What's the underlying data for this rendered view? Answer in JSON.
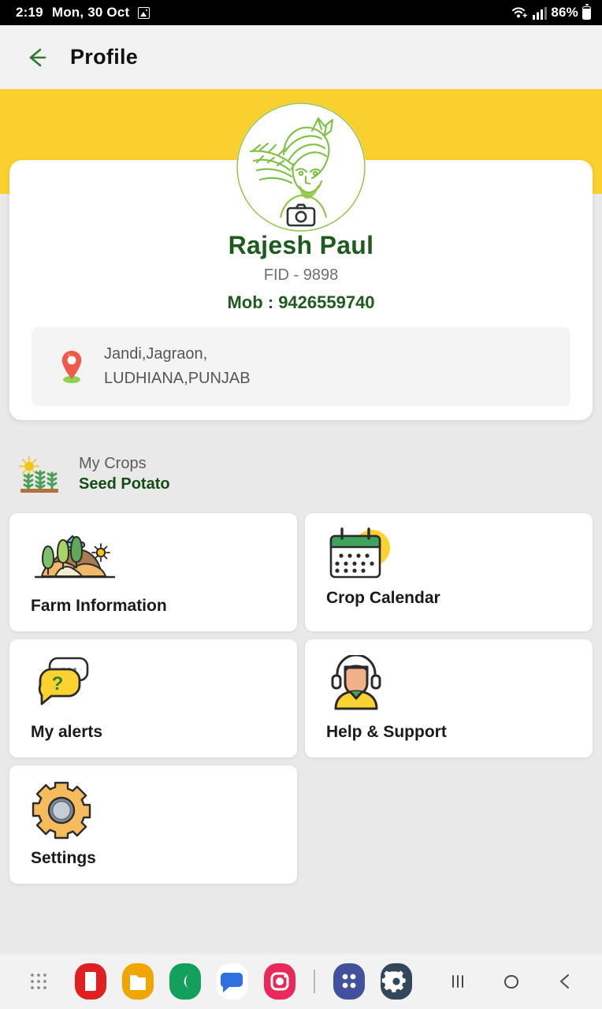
{
  "status_bar": {
    "time": "2:19",
    "date": "Mon, 30 Oct",
    "notification_icon": "image-icon",
    "wifi_icon": "wifi-icon",
    "signal_icon": "cellular-signal-icon",
    "battery_percent": "86%",
    "battery_icon": "battery-icon"
  },
  "header": {
    "back_icon": "back-arrow-icon",
    "title": "Profile",
    "accent_color": "#1d5c1d"
  },
  "banner": {
    "color": "#fad02e"
  },
  "profile": {
    "avatar_icon": "farmer-avatar-icon",
    "camera_icon": "camera-icon",
    "name": "Rajesh Paul",
    "fid": "FID - 9898",
    "mobile": "Mob : 9426559740",
    "location_icon": "location-pin-icon",
    "address_line1": "Jandi,Jagraon,",
    "address_line2": "LUDHIANA,PUNJAB"
  },
  "my_crops": {
    "icon": "crops-sun-icon",
    "label": "My Crops",
    "value": "Seed Potato"
  },
  "tiles": [
    {
      "id": "farm-information",
      "label": "Farm Information",
      "icon": "farm-landscape-icon"
    },
    {
      "id": "crop-calendar",
      "label": "Crop Calendar",
      "icon": "calendar-icon"
    },
    {
      "id": "my-alerts",
      "label": "My alerts",
      "icon": "question-chat-bubble-icon"
    },
    {
      "id": "help-support",
      "label": "Help & Support",
      "icon": "headset-agent-icon"
    },
    {
      "id": "settings",
      "label": "Settings",
      "icon": "gear-icon"
    }
  ],
  "taskbar": {
    "apps_grid_icon": "app-drawer-dots-icon",
    "apps": [
      {
        "name": "pdf-reader-app-icon",
        "color": "#e02020"
      },
      {
        "name": "files-app-icon",
        "color": "#f0a500"
      },
      {
        "name": "phone-app-icon",
        "color": "#12a05c"
      },
      {
        "name": "messages-app-icon",
        "color": "#ffffff"
      },
      {
        "name": "instagram-app-icon",
        "color": "#e8295a"
      },
      {
        "name": "samsung-apps-icon",
        "color": "#41519b"
      },
      {
        "name": "settings-app-icon",
        "color": "#33475b"
      }
    ],
    "nav": [
      {
        "name": "recents-nav-button",
        "glyph": "|||"
      },
      {
        "name": "home-nav-button",
        "glyph": "○"
      },
      {
        "name": "back-nav-button",
        "glyph": "‹"
      }
    ]
  }
}
